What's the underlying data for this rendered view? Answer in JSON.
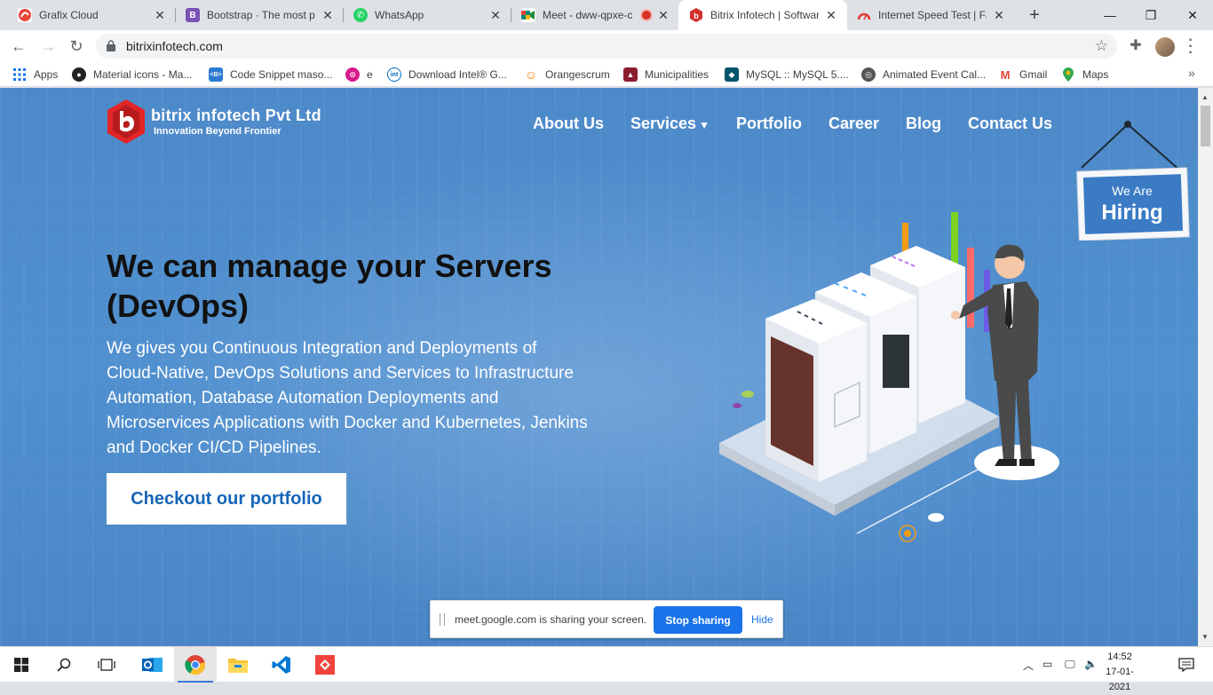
{
  "browser": {
    "tabs": [
      {
        "title": "Grafix Cloud",
        "favicon": "grafix-icon",
        "color": "#e8453c"
      },
      {
        "title": "Bootstrap · The most po",
        "favicon": "bootstrap-icon",
        "color": "#7952b3"
      },
      {
        "title": "WhatsApp",
        "favicon": "whatsapp-icon",
        "color": "#25d366"
      },
      {
        "title": "Meet - dww-qpxe-c",
        "favicon": "meet-icon",
        "color": "#00897b"
      },
      {
        "title": "Bitrix Infotech | Softwar",
        "favicon": "bitrix-icon",
        "color": "#d32f2f"
      },
      {
        "title": "Internet Speed Test | Fa",
        "favicon": "speedtest-icon",
        "color": "#e53935"
      }
    ],
    "url": "bitrixinfotech.com",
    "bookmarks": [
      {
        "label": "Apps"
      },
      {
        "label": "Material icons - Ma..."
      },
      {
        "label": "Code Snippet maso..."
      },
      {
        "label": "e"
      },
      {
        "label": "Download Intel® G..."
      },
      {
        "label": "Orangescrum"
      },
      {
        "label": "Municipalities"
      },
      {
        "label": "MySQL :: MySQL 5...."
      },
      {
        "label": "Animated Event Cal..."
      },
      {
        "label": "Gmail"
      },
      {
        "label": "Maps"
      }
    ]
  },
  "site": {
    "brand_name": "bitrix infotech Pvt Ltd",
    "brand_tagline": "Innovation Beyond Frontier",
    "nav": [
      {
        "label": "About Us"
      },
      {
        "label": "Services"
      },
      {
        "label": "Portfolio"
      },
      {
        "label": "Career"
      },
      {
        "label": "Blog"
      },
      {
        "label": "Contact Us"
      }
    ],
    "hiring_line1": "We Are",
    "hiring_line2": "Hiring",
    "hero_title": "We can manage your Servers (DevOps)",
    "hero_text": "We gives you Continuous Integration and Deployments of Cloud-Native, DevOps Solutions and Services to Infrastructure Automation, Database Automation Deployments and Microservices Applications with Docker and Kubernetes, Jenkins and Docker CI/CD Pipelines.",
    "cta_label": "Checkout our portfolio"
  },
  "sharebar": {
    "message": "meet.google.com is sharing your screen.",
    "stop_label": "Stop sharing",
    "hide_label": "Hide"
  },
  "taskbar": {
    "time": "14:52",
    "date": "17-01-2021"
  },
  "colors": {
    "accent_blue": "#1565b8",
    "hero_bg": "#4d89c9",
    "brand_red": "#e32527"
  }
}
